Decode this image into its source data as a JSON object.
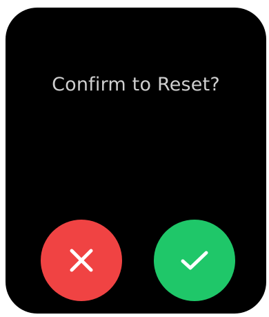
{
  "dialog": {
    "prompt": "Confirm to Reset?"
  },
  "buttons": {
    "cancel": {
      "icon": "close-icon",
      "color": "#f04343"
    },
    "confirm": {
      "icon": "check-icon",
      "color": "#1fc769"
    }
  },
  "colors": {
    "screen_background": "#000000",
    "prompt_text": "#cfcfcf",
    "icon_stroke": "#ffffff"
  }
}
